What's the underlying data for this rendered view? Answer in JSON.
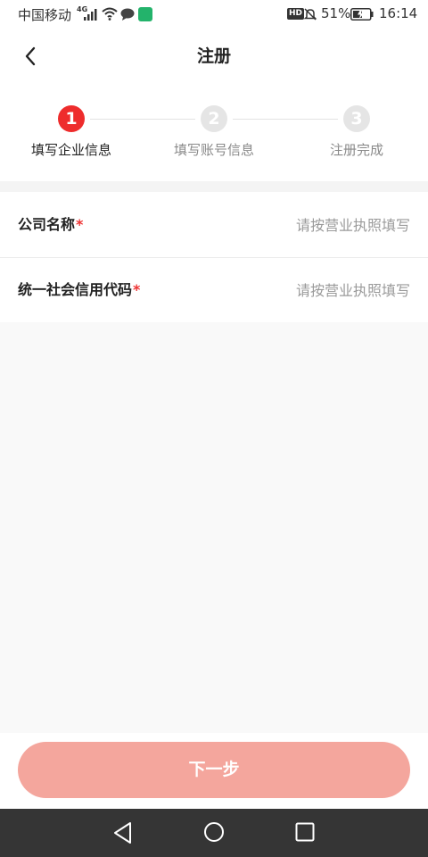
{
  "status_bar": {
    "carrier": "中国移动",
    "network": "4G",
    "battery": "51%",
    "time": "16:14",
    "hd_badge": "HD"
  },
  "header": {
    "title": "注册"
  },
  "steps": [
    {
      "number": "1",
      "label": "填写企业信息",
      "active": true
    },
    {
      "number": "2",
      "label": "填写账号信息",
      "active": false
    },
    {
      "number": "3",
      "label": "注册完成",
      "active": false
    }
  ],
  "form": {
    "company_name": {
      "label": "公司名称",
      "required_mark": "*",
      "placeholder": "请按营业执照填写",
      "value": ""
    },
    "credit_code": {
      "label": "统一社会信用代码",
      "required_mark": "*",
      "placeholder": "请按营业执照填写",
      "value": ""
    }
  },
  "next_button": {
    "label": "下一步"
  },
  "colors": {
    "accent": "#ee2c2c",
    "button_disabled": "#f4a69d",
    "nav_bar": "#353535"
  }
}
